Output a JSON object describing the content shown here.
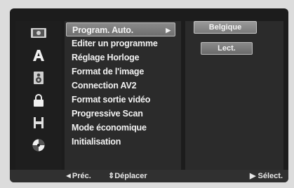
{
  "icons": [
    "disc-icon",
    "letter-a-icon",
    "speaker-icon",
    "padlock-icon",
    "film-icon",
    "disc-circle-icon"
  ],
  "menu": {
    "items": [
      {
        "label": "Program. Auto.",
        "selected": true
      },
      {
        "label": "Editer un programme"
      },
      {
        "label": "Réglage Horloge"
      },
      {
        "label": "Format de l'image"
      },
      {
        "label": "Connection AV2"
      },
      {
        "label": "Format sortie vidéo"
      },
      {
        "label": "Progressive Scan"
      },
      {
        "label": "Mode économique"
      },
      {
        "label": "Initialisation"
      }
    ],
    "arrow": "▶"
  },
  "options": {
    "country": "Belgique",
    "action": "Lect."
  },
  "footer": {
    "prev": "◄Préc.",
    "move": "⇕Déplacer",
    "select": "▶ Sélect."
  }
}
